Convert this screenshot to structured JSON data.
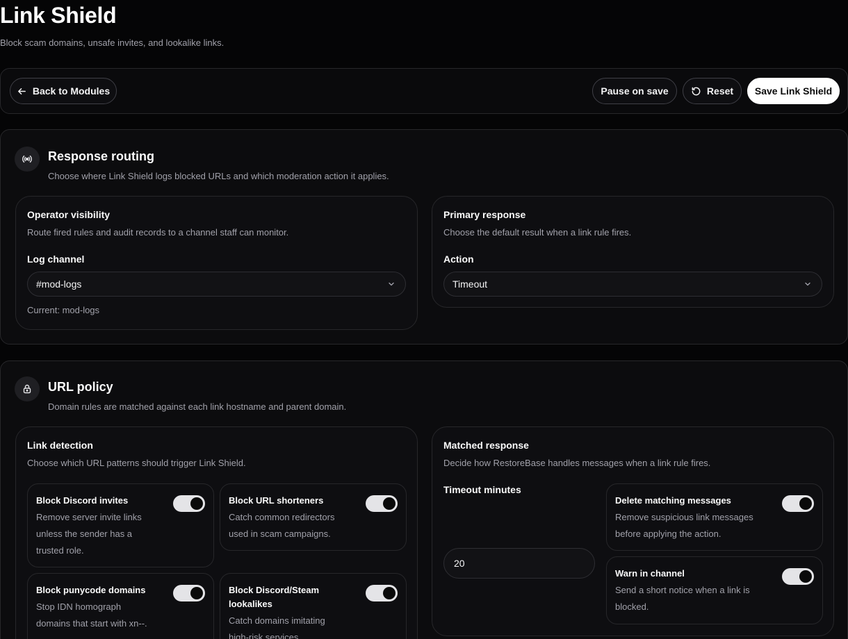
{
  "header": {
    "title": "Link Shield",
    "subtitle": "Block scam domains, unsafe invites, and lookalike links."
  },
  "toolbar": {
    "back_label": "Back to Modules",
    "pause_label": "Pause on save",
    "reset_label": "Reset",
    "save_label": "Save Link Shield"
  },
  "response_routing": {
    "icon": "broadcast-icon",
    "title": "Response routing",
    "description": "Choose where Link Shield logs blocked URLs and which moderation action it applies.",
    "operator": {
      "title": "Operator visibility",
      "description": "Route fired rules and audit records to a channel staff can monitor.",
      "field_label": "Log channel",
      "selected": "#mod-logs",
      "current": "Current: mod-logs"
    },
    "primary": {
      "title": "Primary response",
      "description": "Choose the default result when a link rule fires.",
      "field_label": "Action",
      "selected": "Timeout"
    }
  },
  "url_policy": {
    "icon": "lock-icon",
    "title": "URL policy",
    "description": "Domain rules are matched against each link hostname and parent domain.",
    "detection": {
      "title": "Link detection",
      "description": "Choose which URL patterns should trigger Link Shield.",
      "toggles": [
        {
          "title": "Block Discord invites",
          "description": "Remove server invite links unless the sender has a trusted role.",
          "on": true
        },
        {
          "title": "Block URL shorteners",
          "description": "Catch common redirectors used in scam campaigns.",
          "on": true
        },
        {
          "title": "Block punycode domains",
          "description": "Stop IDN homograph domains that start with xn--.",
          "on": true
        },
        {
          "title": "Block Discord/Steam lookalikes",
          "description": "Catch domains imitating high-risk services.",
          "on": true
        }
      ]
    },
    "matched": {
      "title": "Matched response",
      "description": "Decide how RestoreBase handles messages when a link rule fires.",
      "timeout_label": "Timeout minutes",
      "timeout_value": "20",
      "toggles": [
        {
          "title": "Delete matching messages",
          "description": "Remove suspicious link messages before applying the action.",
          "on": true
        },
        {
          "title": "Warn in channel",
          "description": "Send a short notice when a link is blocked.",
          "on": true
        }
      ]
    }
  }
}
